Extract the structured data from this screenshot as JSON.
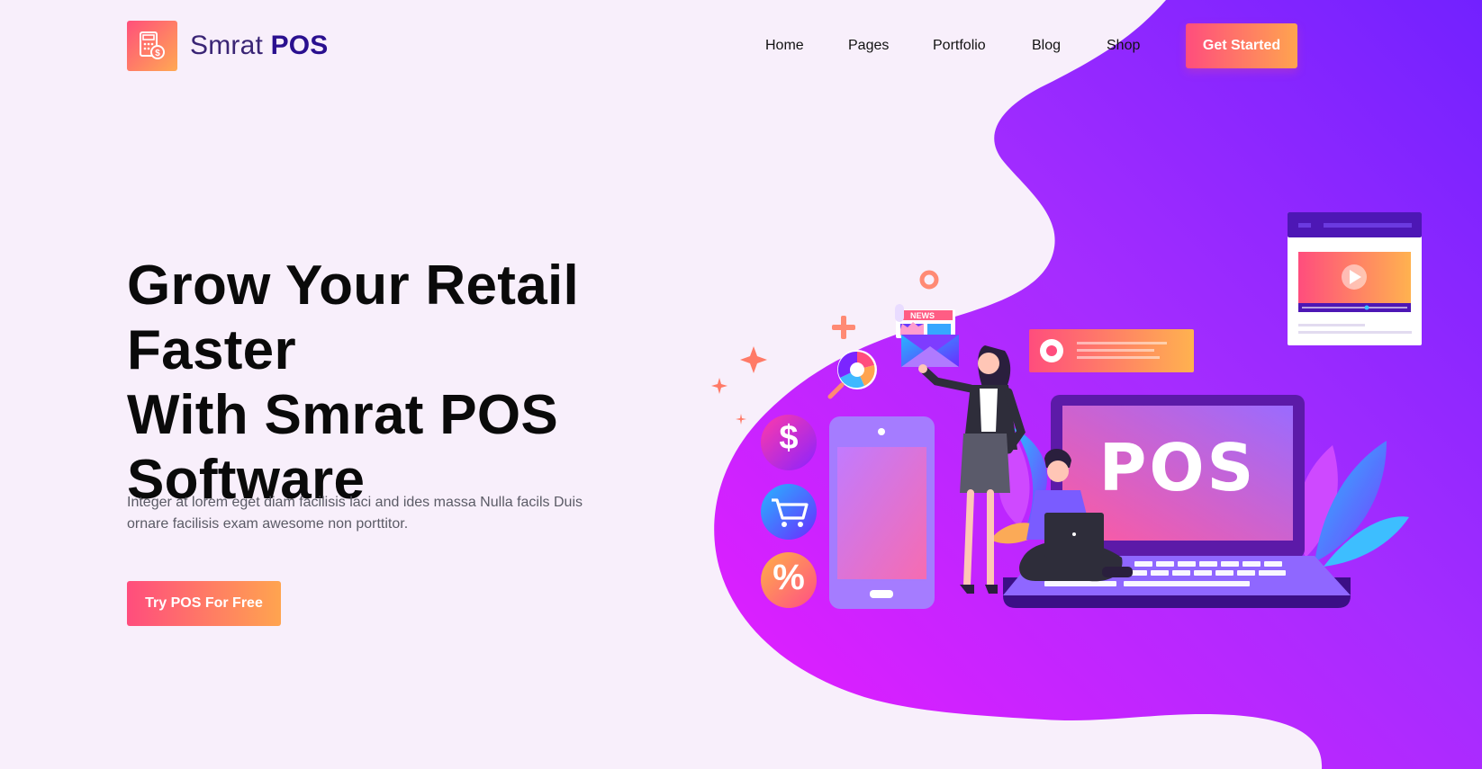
{
  "brand": {
    "name_light": "Smrat",
    "name_bold": "POS",
    "icon": "calculator-dollar-icon",
    "gradient": [
      "#ff4f7b",
      "#ffa953"
    ]
  },
  "nav": {
    "items": [
      "Home",
      "Pages",
      "Portfolio",
      "Blog",
      "Shop"
    ],
    "cta_label": "Get Started"
  },
  "hero": {
    "title_lines": [
      "Grow Your Retail Faster",
      "With Smrat POS",
      "Software"
    ],
    "description": "Integer at lorem eget diam facilisis laci and ides massa Nulla facils Duis ornare facilisis exam awesome non porttitor.",
    "cta_label": "Try POS For Free"
  },
  "illustration": {
    "laptop_text": "POS",
    "envelope_badge": "NEWS",
    "coin_dollar": "$",
    "coin_percent": "%",
    "icons": [
      "dollar-coin-icon",
      "cart-coin-icon",
      "percent-coin-icon",
      "play-icon",
      "plus-icon",
      "sparkle-icon",
      "pie-chart-icon",
      "envelope-icon"
    ]
  },
  "colors": {
    "background": "#f8effb",
    "blob_start": "#e81cff",
    "blob_end": "#7b25ff",
    "accent_pink": "#ff4d7d",
    "accent_orange": "#ffa44f",
    "brand_navy": "#2a108f"
  }
}
